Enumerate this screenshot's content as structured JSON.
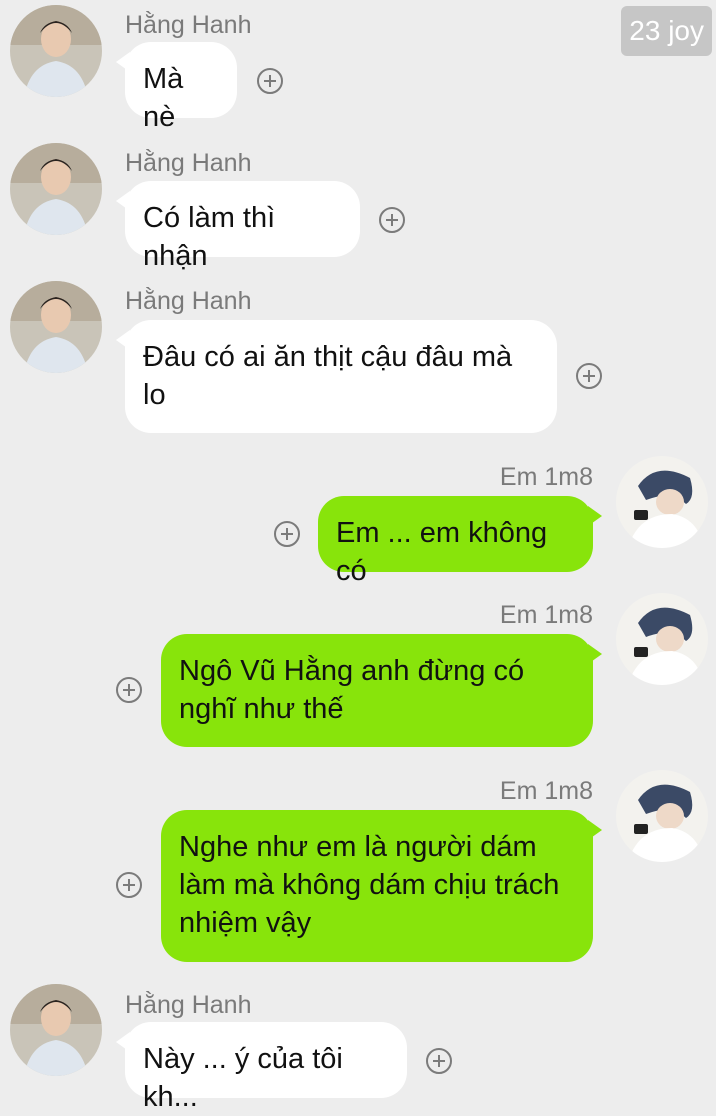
{
  "watermark": "23 joy",
  "icons": {
    "avatar_left": "avatar-photo",
    "avatar_right": "avatar-photo",
    "add": "plus-circle-icon"
  },
  "colors": {
    "background": "#ededed",
    "incoming_bubble": "#ffffff",
    "outgoing_bubble": "#88e40b",
    "name_text": "#7a7a7a"
  },
  "messages": [
    {
      "sender": "Hằng Hanh",
      "text": "Mà nè"
    },
    {
      "sender": "Hằng Hanh",
      "text": "Có làm thì nhận"
    },
    {
      "sender": "Hằng Hanh",
      "text": "Đâu có ai ăn thịt cậu đâu mà lo"
    },
    {
      "sender": "Em 1m8",
      "text": "Em ... em không có"
    },
    {
      "sender": "Em 1m8",
      "text": "Ngô Vũ Hằng anh đừng có nghĩ như thế"
    },
    {
      "sender": "Em 1m8",
      "text": "Nghe như em là người dám làm mà không dám chịu trách nhiệm vậy"
    },
    {
      "sender": "Hằng Hanh",
      "text": "Này ... ý của tôi kh..."
    }
  ]
}
